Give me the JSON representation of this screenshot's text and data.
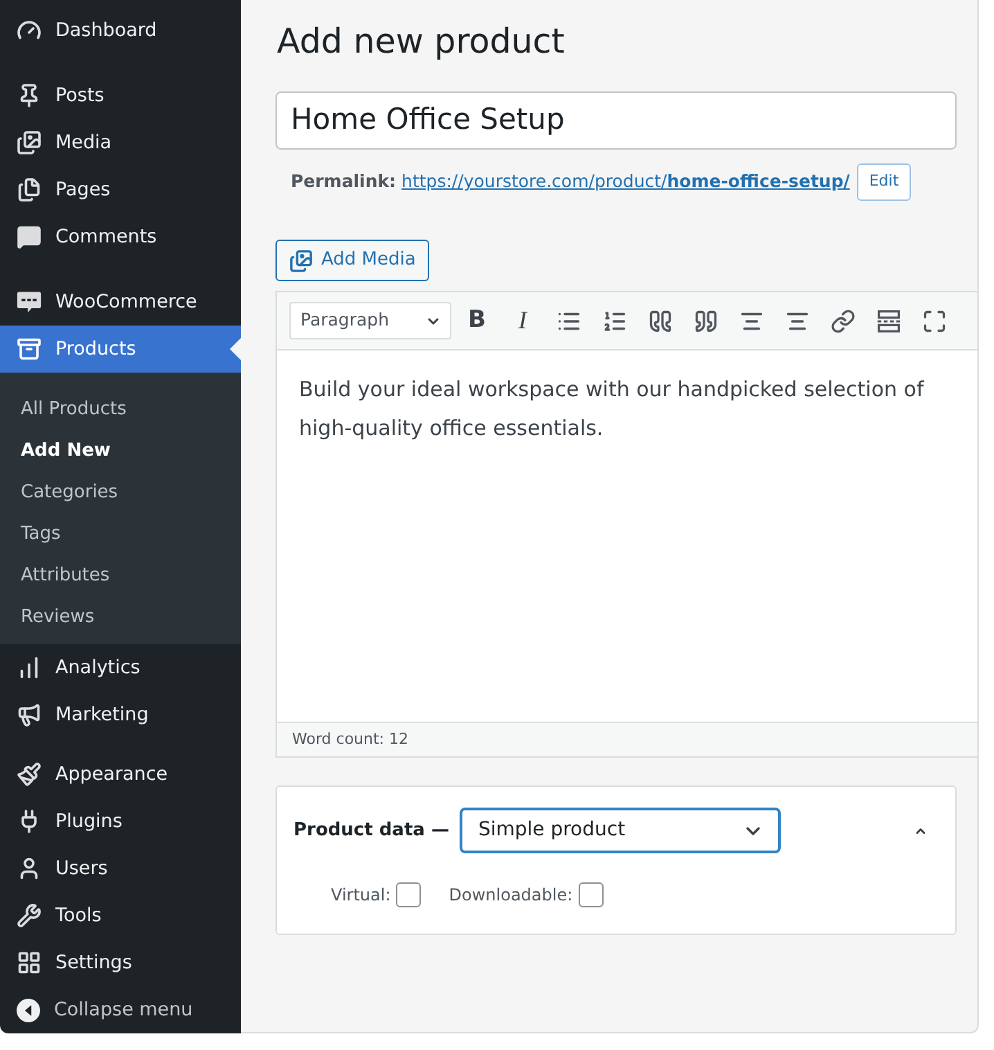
{
  "sidebar": {
    "groups": [
      {
        "items": [
          {
            "label": "Dashboard",
            "selected": false
          }
        ]
      },
      {
        "items": [
          {
            "label": "Posts",
            "selected": false
          },
          {
            "label": "Media",
            "selected": false
          },
          {
            "label": "Pages",
            "selected": false
          },
          {
            "label": "Comments",
            "selected": false
          }
        ]
      },
      {
        "items": [
          {
            "label": "WooCommerce",
            "selected": false
          },
          {
            "label": "Products",
            "selected": true,
            "children": [
              {
                "label": "All Products",
                "selected": false
              },
              {
                "label": "Add New",
                "selected": true
              },
              {
                "label": "Categories",
                "selected": false
              },
              {
                "label": "Tags",
                "selected": false
              },
              {
                "label": "Attributes",
                "selected": false
              },
              {
                "label": "Reviews",
                "selected": false
              }
            ]
          },
          {
            "label": "Analytics",
            "selected": false
          },
          {
            "label": "Marketing",
            "selected": false
          }
        ]
      },
      {
        "items": [
          {
            "label": "Appearance",
            "selected": false
          },
          {
            "label": "Plugins",
            "selected": false
          },
          {
            "label": "Users",
            "selected": false
          },
          {
            "label": "Tools",
            "selected": false
          },
          {
            "label": "Settings",
            "selected": false
          }
        ]
      }
    ],
    "collapse_menu": "Collapse menu"
  },
  "page_title": "Add new product",
  "title_field": {
    "value": "Home Office Setup"
  },
  "permalink": {
    "label": "Permalink:",
    "url": "https://yourstore.com/product/**home-office-setup/**",
    "edit_button": "Edit"
  },
  "add_media_button": "Add Media",
  "editor": {
    "toolbar": {
      "format": "Paragraph",
      "text_buttons": [
        "B",
        "I"
      ]
    },
    "content": "Build your ideal workspace with our handpicked selection of high-quality office essentials.",
    "word_count": "Word count: 12"
  },
  "product_data": {
    "label": "Product data —",
    "expanded": true,
    "type_select": {
      "value": "Simple product",
      "focused": true
    },
    "options": [
      {
        "label": "Virtual:",
        "checked": false
      },
      {
        "label": "Downloadable:",
        "checked": false
      }
    ]
  }
}
